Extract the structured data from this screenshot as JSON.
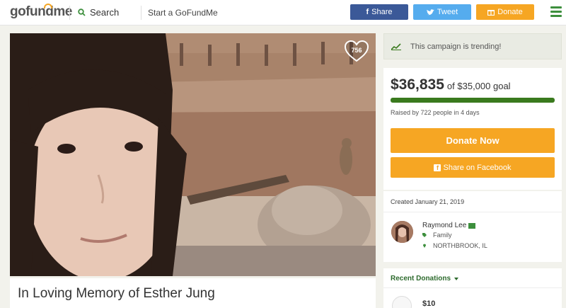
{
  "header": {
    "logo": "gofundme",
    "search_label": "Search",
    "start_label": "Start a GoFundMe",
    "share_label": "Share",
    "tweet_label": "Tweet",
    "donate_label": "Donate"
  },
  "hero": {
    "heart_count": "756"
  },
  "campaign": {
    "title": "In Loving Memory of Esther Jung"
  },
  "trending": {
    "text": "This campaign is trending!"
  },
  "funding": {
    "raised": "$36,835",
    "goal": "of $35,000 goal",
    "progress_fraction": 1.0,
    "raised_by": "Raised by 722 people in 4 days",
    "donate_now_label": "Donate Now",
    "share_facebook_label": "Share on Facebook"
  },
  "organizer": {
    "created": "Created January 21, 2019",
    "name": "Raymond Lee",
    "category": "Family",
    "location": "NORTHBROOK, IL"
  },
  "recent": {
    "title": "Recent Donations",
    "first_amount": "$10"
  },
  "colors": {
    "brand_green": "#3a7a1e",
    "donate_orange": "#f6a623",
    "facebook_blue": "#3b5998",
    "twitter_blue": "#55acee"
  }
}
